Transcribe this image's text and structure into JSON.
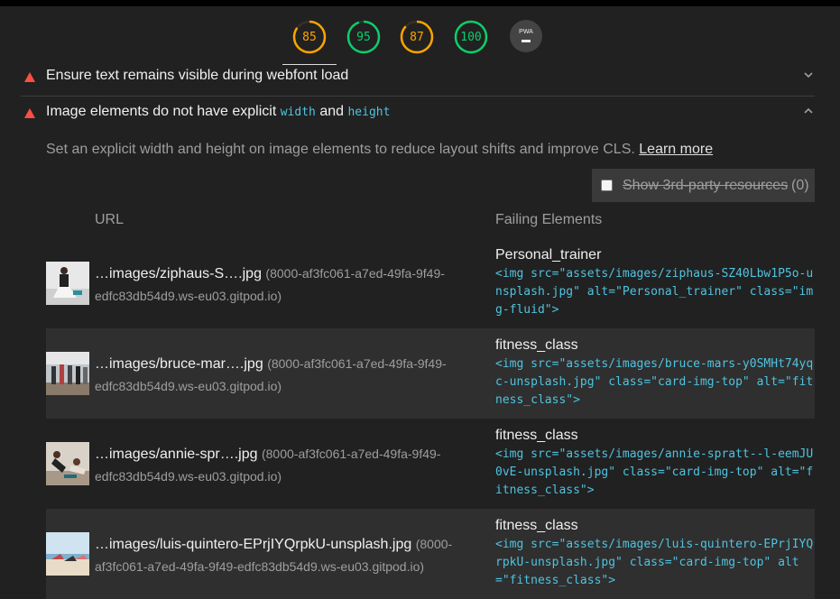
{
  "scores": [
    {
      "label": "85",
      "fraction": 0.85,
      "color": "#ffa400"
    },
    {
      "label": "95",
      "fraction": 0.95,
      "color": "#0cce6b"
    },
    {
      "label": "87",
      "fraction": 0.87,
      "color": "#ffa400"
    },
    {
      "label": "100",
      "fraction": 1.0,
      "color": "#0cce6b"
    }
  ],
  "pwa": {
    "label": "PWA"
  },
  "audits": {
    "webfont": {
      "title": "Ensure text remains visible during webfont load"
    },
    "image_dims": {
      "title_prefix": "Image elements do not have explicit",
      "code1": "width",
      "and": "and",
      "code2": "height",
      "description": "Set an explicit width and height on image elements to reduce layout shifts and improve CLS.",
      "learn_more": "Learn more"
    }
  },
  "filter": {
    "label": "Show 3rd-party resources",
    "count": "(0)"
  },
  "table": {
    "headers": {
      "url": "URL",
      "failing": "Failing Elements"
    },
    "rows": [
      {
        "url": "…images/ziphaus-S….jpg",
        "host": "(8000-af3fc061-a7ed-49fa-9f49-edfc83db54d9.ws-eu03.gitpod.io)",
        "label": "Personal_trainer",
        "snippet": "<img src=\"assets/images/ziphaus-SZ40Lbw1P5o-unsplash.jpg\" alt=\"Personal_trainer\" class=\"img-fluid\">"
      },
      {
        "url": "…images/bruce-mar….jpg",
        "host": "(8000-af3fc061-a7ed-49fa-9f49-edfc83db54d9.ws-eu03.gitpod.io)",
        "label": "fitness_class",
        "snippet": "<img src=\"assets/images/bruce-mars-y0SMHt74yqc-unsplash.jpg\" class=\"card-img-top\" alt=\"fitness_class\">"
      },
      {
        "url": "…images/annie-spr….jpg",
        "host": "(8000-af3fc061-a7ed-49fa-9f49-edfc83db54d9.ws-eu03.gitpod.io)",
        "label": "fitness_class",
        "snippet": "<img src=\"assets/images/annie-spratt--l-eemJU0vE-unsplash.jpg\" class=\"card-img-top\" alt=\"fitness_class\">"
      },
      {
        "url": "…images/luis-quintero-EPrjIYQrpkU-unsplash.jpg",
        "host": "(8000-af3fc061-a7ed-49fa-9f49-edfc83db54d9.ws-eu03.gitpod.io)",
        "label": "fitness_class",
        "snippet": "<img src=\"assets/images/luis-quintero-EPrjIYQrpkU-unsplash.jpg\" class=\"card-img-top\" alt=\"fitness_class\">"
      }
    ]
  }
}
